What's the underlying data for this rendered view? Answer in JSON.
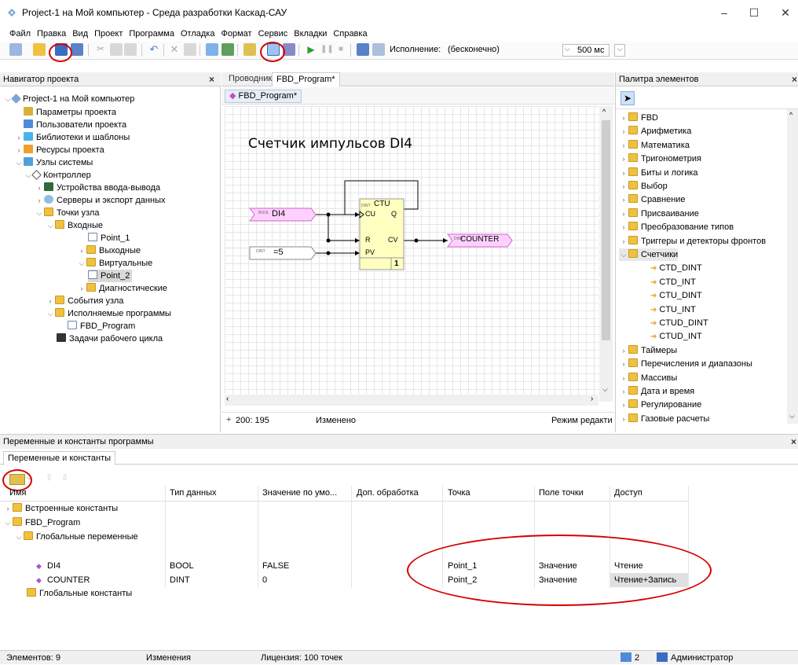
{
  "window": {
    "title": "Project-1 на Мой компьютер - Среда разработки Каскад-САУ"
  },
  "menu": [
    "Файл",
    "Правка",
    "Вид",
    "Проект",
    "Программа",
    "Отладка",
    "Формат",
    "Сервис",
    "Вкладки",
    "Справка"
  ],
  "toolbar": {
    "execution_label": "Исполнение:",
    "execution_value": "(бесконечно)",
    "period_value": "500 мс"
  },
  "navigator": {
    "title": "Навигатор проекта",
    "items": [
      {
        "label": "Project-1 на Мой компьютер",
        "icon": "project-icon"
      },
      {
        "label": "Параметры проекта",
        "icon": "settings-icon"
      },
      {
        "label": "Пользователи проекта",
        "icon": "users-icon"
      },
      {
        "label": "Библиотеки и шаблоны",
        "icon": "library-icon"
      },
      {
        "label": "Ресурсы проекта",
        "icon": "resources-icon"
      },
      {
        "label": "Узлы системы",
        "icon": "nodes-icon"
      },
      {
        "label": "Контроллер",
        "icon": "controller-icon"
      },
      {
        "label": "Устройства ввода-вывода",
        "icon": "io-icon"
      },
      {
        "label": "Серверы и экспорт данных",
        "icon": "server-icon"
      },
      {
        "label": "Точки узла",
        "icon": "folder-icon"
      },
      {
        "label": "Входные",
        "icon": "folder-icon"
      },
      {
        "label": "Point_1",
        "icon": "point-icon"
      },
      {
        "label": "Выходные",
        "icon": "folder-icon"
      },
      {
        "label": "Виртуальные",
        "icon": "folder-icon"
      },
      {
        "label": "Point_2",
        "icon": "point-icon"
      },
      {
        "label": "Диагностические",
        "icon": "folder-icon"
      },
      {
        "label": "События узла",
        "icon": "folder-icon"
      },
      {
        "label": "Исполняемые программы",
        "icon": "folder-icon"
      },
      {
        "label": "FBD_Program",
        "icon": "program-icon"
      },
      {
        "label": "Задачи рабочего цикла",
        "icon": "tasks-icon"
      }
    ]
  },
  "editor": {
    "tabs": [
      "Проводник",
      "FBD_Program*"
    ],
    "doc_tab": "FBD_Program*",
    "diagram_title": "Счетчик импульсов DI4",
    "block": {
      "name": "CTU",
      "type_small": "DINT",
      "in1": "CU",
      "in2": "R",
      "in3": "PV",
      "out1": "Q",
      "out2": "CV",
      "order": "1"
    },
    "var_in": {
      "type": "BOOL",
      "name": "DI4"
    },
    "const_in": {
      "type": "DINT",
      "value": "=5"
    },
    "var_out": {
      "type": "DINT",
      "name": "COUNTER"
    },
    "status": {
      "coords": "200: 195",
      "state": "Изменено",
      "mode": "Режим редакти"
    }
  },
  "palette": {
    "title": "Палитра элементов",
    "items": [
      {
        "label": "FBD",
        "kind": "folder"
      },
      {
        "label": "Арифметика",
        "kind": "folder"
      },
      {
        "label": "Математика",
        "kind": "folder"
      },
      {
        "label": "Тригонометрия",
        "kind": "folder"
      },
      {
        "label": "Биты и логика",
        "kind": "folder"
      },
      {
        "label": "Выбор",
        "kind": "folder"
      },
      {
        "label": "Сравнение",
        "kind": "folder"
      },
      {
        "label": "Присваивание",
        "kind": "folder"
      },
      {
        "label": "Преобразование типов",
        "kind": "folder"
      },
      {
        "label": "Триггеры и детекторы фронтов",
        "kind": "folder"
      },
      {
        "label": "Счетчики",
        "kind": "folder-open"
      },
      {
        "label": "CTD_DINT",
        "kind": "block"
      },
      {
        "label": "CTD_INT",
        "kind": "block"
      },
      {
        "label": "CTU_DINT",
        "kind": "block"
      },
      {
        "label": "CTU_INT",
        "kind": "block"
      },
      {
        "label": "CTUD_DINT",
        "kind": "block"
      },
      {
        "label": "CTUD_INT",
        "kind": "block"
      },
      {
        "label": "Таймеры",
        "kind": "folder"
      },
      {
        "label": "Перечисления и диапазоны",
        "kind": "folder"
      },
      {
        "label": "Массивы",
        "kind": "folder"
      },
      {
        "label": "Дата и время",
        "kind": "folder"
      },
      {
        "label": "Регулирование",
        "kind": "folder"
      },
      {
        "label": "Газовые расчеты",
        "kind": "folder"
      }
    ]
  },
  "vars": {
    "panel_title": "Переменные и константы программы",
    "tab": "Переменные и константы",
    "columns": [
      "Имя",
      "Тип данных",
      "Значение по умо...",
      "Доп. обработка",
      "Точка",
      "Поле точки",
      "Доступ"
    ],
    "groups": {
      "builtin": "Встроенные константы",
      "program": "FBD_Program",
      "globals": "Глобальные переменные",
      "global_consts": "Глобальные константы"
    },
    "rows": [
      {
        "name": "DI4",
        "type": "BOOL",
        "default": "FALSE",
        "extra": "",
        "point": "Point_1",
        "field": "Значение",
        "access": "Чтение"
      },
      {
        "name": "COUNTER",
        "type": "DINT",
        "default": "0",
        "extra": "",
        "point": "Point_2",
        "field": "Значение",
        "access": "Чтение+Запись"
      }
    ]
  },
  "statusbar": {
    "elements": "Элементов: 9",
    "changes": "Изменения",
    "license": "Лицензия: 100 точек",
    "users": "2",
    "user": "Администратор"
  },
  "colors": {
    "block_fill": "#ffffc0",
    "var_fill": "#ffd0ff",
    "var_border": "#cc66cc",
    "annotation": "#d40000"
  }
}
